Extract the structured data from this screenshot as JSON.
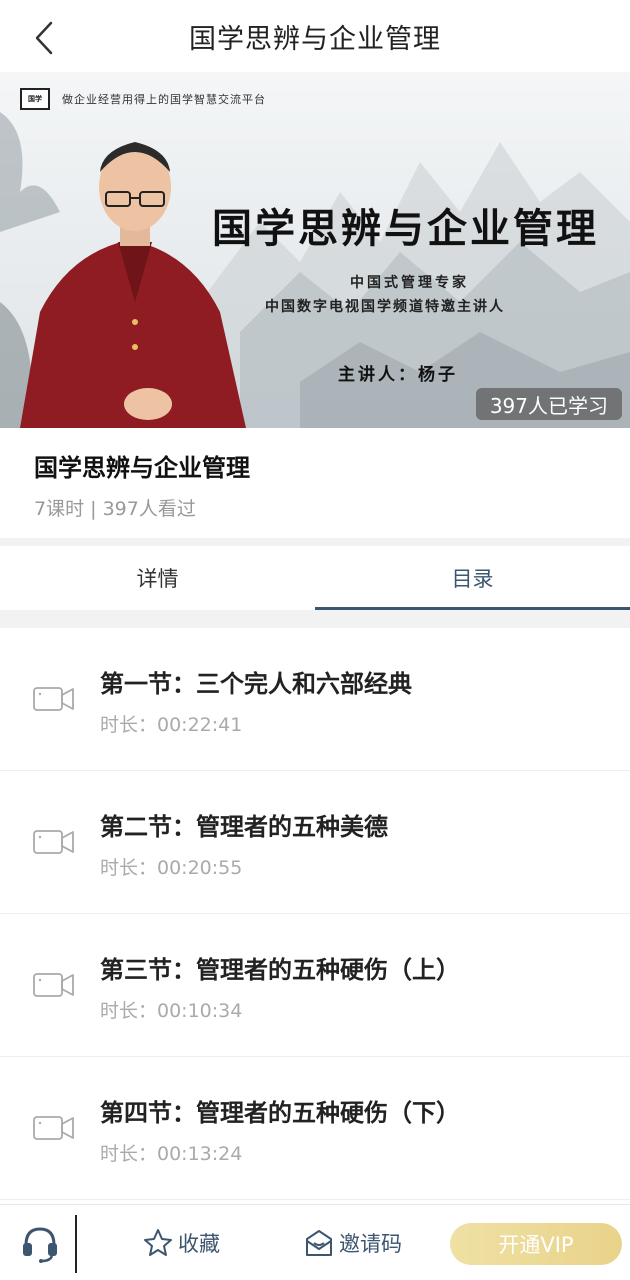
{
  "header": {
    "title": "国学思辨与企业管理",
    "back_icon": "chevron-left-icon"
  },
  "banner": {
    "logo_text": "国学",
    "slogan": "做企业经营用得上的国学智慧交流平台",
    "title": "国学思辨与企业管理",
    "subtitle1": "中国式管理专家",
    "subtitle2": "中国数字电视国学频道特邀主讲人",
    "speaker": "主讲人：杨子",
    "learn_count": "397人已学习"
  },
  "course": {
    "title": "国学思辨与企业管理",
    "meta": "7课时 | 397人看过"
  },
  "tabs": [
    {
      "label": "详情",
      "active": false
    },
    {
      "label": "目录",
      "active": true
    }
  ],
  "lessons": [
    {
      "title": "第一节：三个完人和六部经典",
      "duration": "时长：00:22:41"
    },
    {
      "title": "第二节：管理者的五种美德",
      "duration": "时长：00:20:55"
    },
    {
      "title": "第三节：管理者的五种硬伤（上）",
      "duration": "时长：00:10:34"
    },
    {
      "title": "第四节：管理者的五种硬伤（下）",
      "duration": "时长：00:13:24"
    }
  ],
  "bottom_bar": {
    "support_icon": "headset-icon",
    "favorite_label": "收藏",
    "favorite_icon": "star-icon",
    "invite_label": "邀请码",
    "invite_icon": "ticket-icon",
    "vip_label": "开通VIP"
  },
  "colors": {
    "accent": "#3d5670",
    "vip": "#e9d38a",
    "muted": "#999999"
  }
}
